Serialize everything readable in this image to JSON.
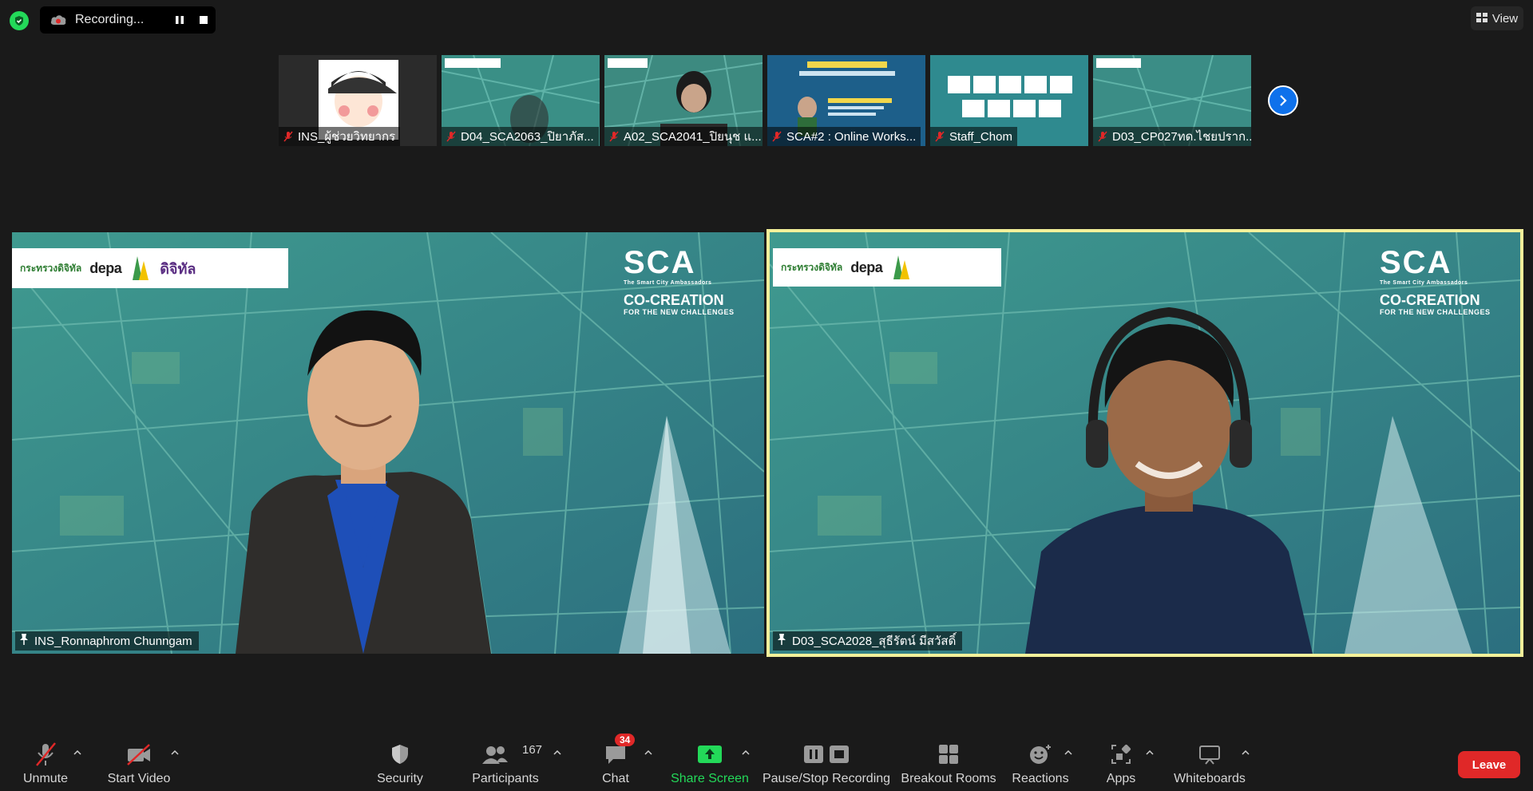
{
  "recording": {
    "label": "Recording..."
  },
  "view_button": {
    "label": "View"
  },
  "thumbnails": [
    {
      "name": "INS_ผู้ช่วยวิทยากร"
    },
    {
      "name": "D04_SCA2063_ปิยาภัส..."
    },
    {
      "name": "A02_SCA2041_ปิยนุช แ..."
    },
    {
      "name": "SCA#2 : Online Works..."
    },
    {
      "name": "Staff_Chom"
    },
    {
      "name": "D03_CP027ทด.ไชยปราก..."
    }
  ],
  "videos": {
    "left": {
      "name": "INS_Ronnaphrom Chunngam",
      "logos": {
        "ministry": "กระทรวงดิจิทัล",
        "depa": "depa",
        "digital": "ดิจิทัล"
      },
      "sca": {
        "big": "SCA",
        "small": "The Smart City Ambassadors",
        "co": "CO-CREATION",
        "sub": "FOR THE NEW CHALLENGES"
      }
    },
    "right": {
      "name": "D03_SCA2028_สุธีรัตน์ มีสวัสดิ์",
      "logos": {
        "ministry": "กระทรวงดิจิทัล",
        "depa": "depa"
      },
      "sca": {
        "big": "SCA",
        "small": "The Smart City Ambassadors",
        "co": "CO-CREATION",
        "sub": "FOR THE NEW CHALLENGES"
      }
    }
  },
  "toolbar": {
    "unmute": "Unmute",
    "start_video": "Start Video",
    "security": "Security",
    "participants": "Participants",
    "participants_count": "167",
    "chat": "Chat",
    "chat_badge": "34",
    "share_screen": "Share Screen",
    "pause_stop": "Pause/Stop Recording",
    "breakout": "Breakout Rooms",
    "reactions": "Reactions",
    "apps": "Apps",
    "whiteboards": "Whiteboards",
    "leave": "Leave"
  },
  "colors": {
    "accent_green": "#23d959",
    "accent_blue": "#0e71eb",
    "leave_red": "#e02828",
    "active_speaker_border": "#f4f19a"
  }
}
